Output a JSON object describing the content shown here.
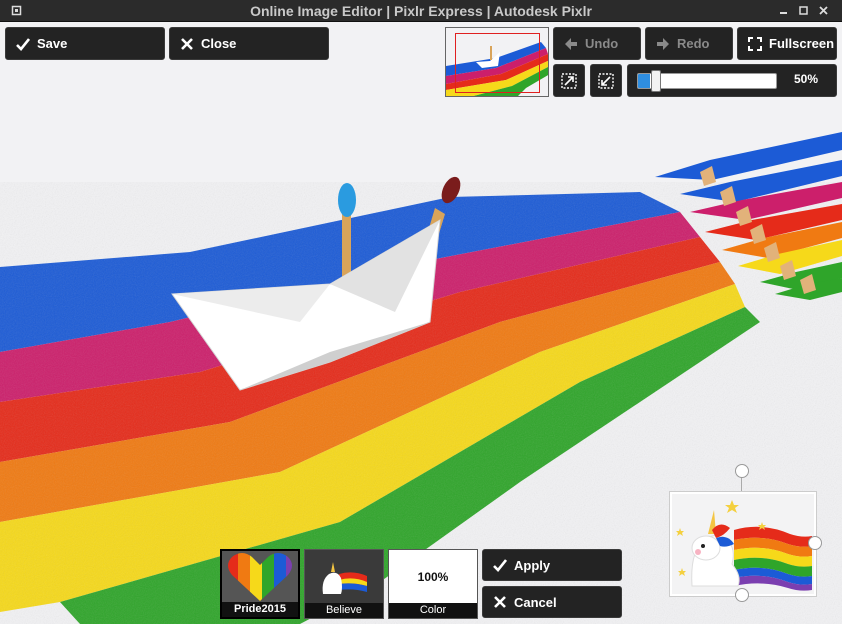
{
  "window": {
    "title": "Online Image Editor | Pixlr Express | Autodesk Pixlr"
  },
  "toolbar": {
    "save_label": "Save",
    "close_label": "Close",
    "undo_label": "Undo",
    "redo_label": "Redo",
    "fullscreen_label": "Fullscreen",
    "zoom_label": "50%",
    "zoom_level": 0.5
  },
  "overlays": {
    "items": [
      {
        "label": "Pride2015",
        "selected": true
      },
      {
        "label": "Believe",
        "selected": false
      }
    ],
    "color_label": "Color",
    "opacity_label": "100%",
    "apply_label": "Apply",
    "cancel_label": "Cancel"
  },
  "colors": {
    "toolbar_bg": "#232323",
    "accent": "#2f8ee0",
    "nav_frame": "#e02020",
    "rainbow": [
      "#1c5bd6",
      "#cc1f6b",
      "#e52b1a",
      "#f07a12",
      "#f6d91a",
      "#2fa52a"
    ]
  },
  "icons": [
    "window-menu-icon",
    "minimize-icon",
    "maximize-icon",
    "close-window-icon",
    "checkmark-icon",
    "x-icon",
    "arrow-left-icon",
    "arrow-right-icon",
    "fullscreen-icon",
    "zoom-fit-icon",
    "zoom-actual-icon"
  ]
}
